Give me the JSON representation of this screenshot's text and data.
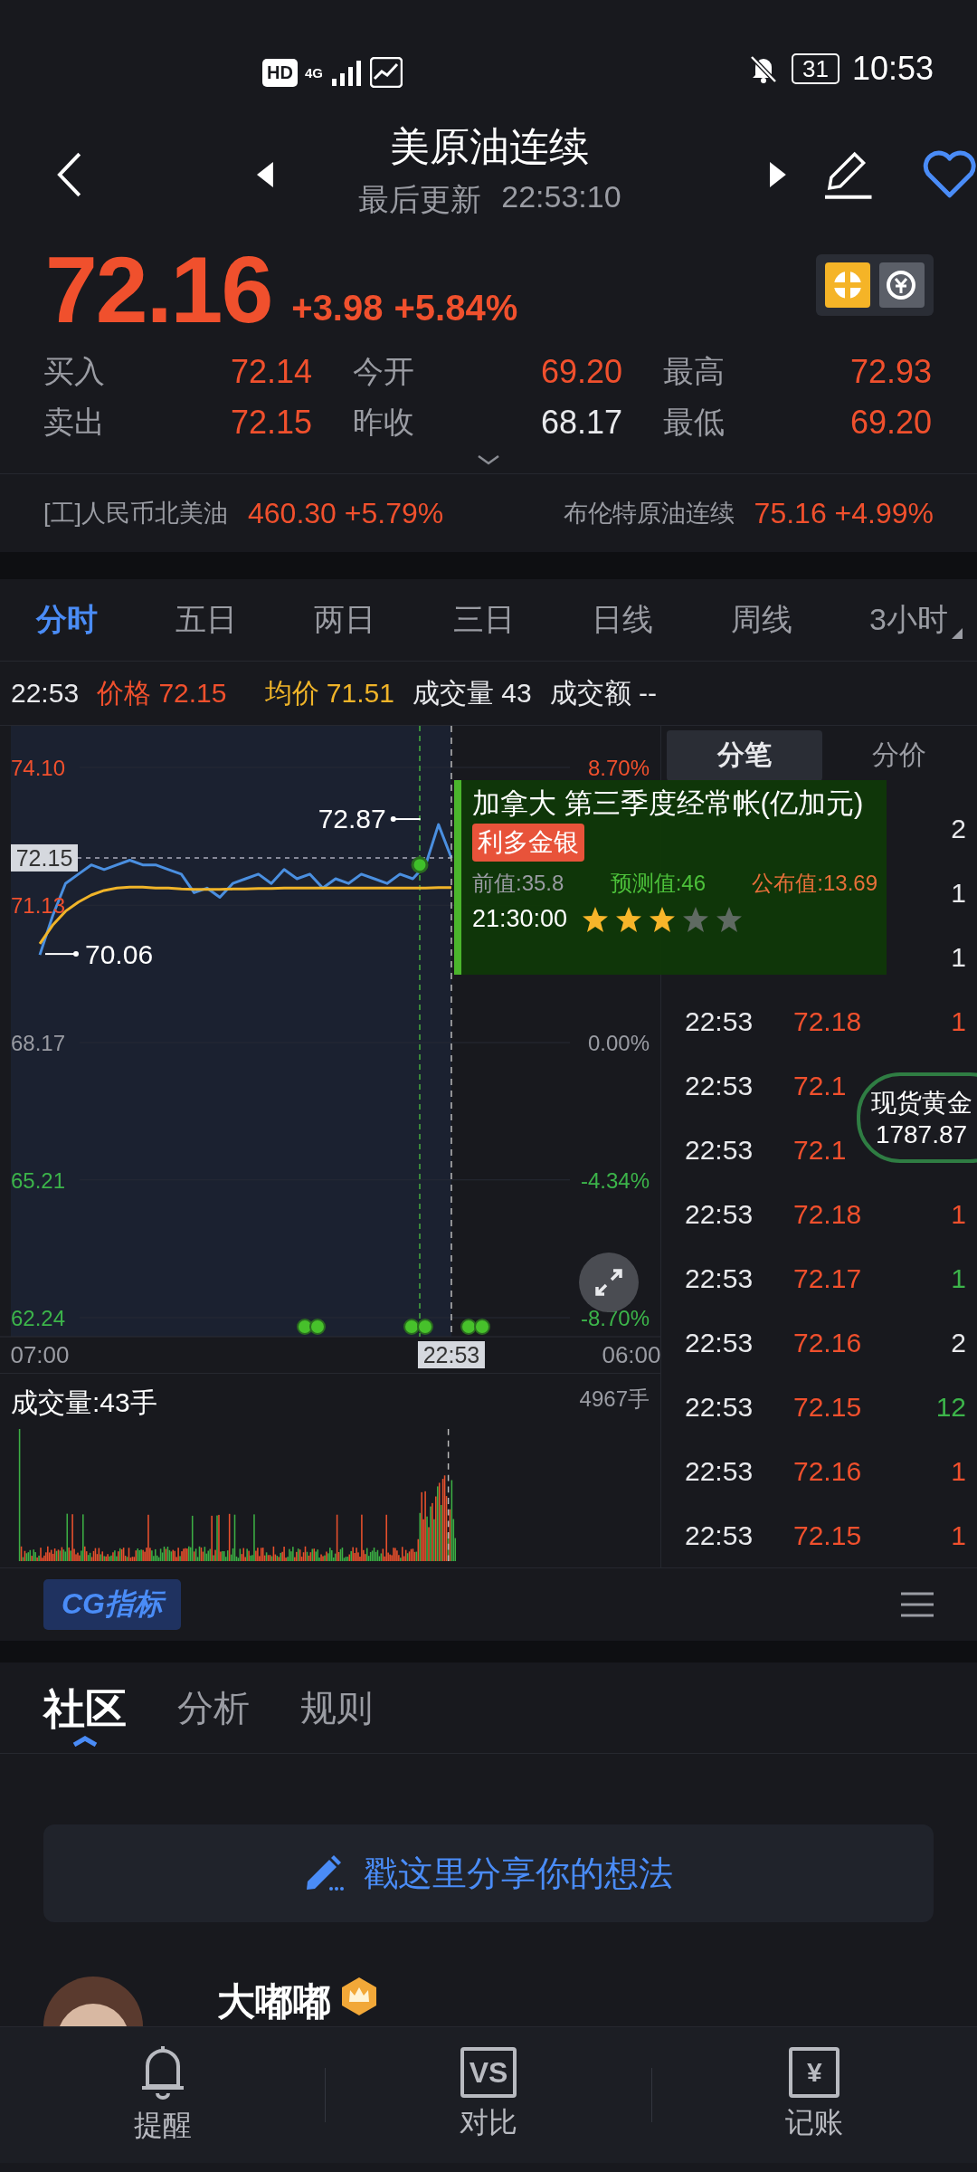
{
  "status_bar": {
    "hd": "HD",
    "network": "4G",
    "battery": "31",
    "time": "10:53"
  },
  "header": {
    "title": "美原油连续",
    "updated_label": "最后更新",
    "updated": "22:53:10"
  },
  "quote": {
    "price": "72.16",
    "change": "+3.98",
    "change_pct": "+5.84%",
    "color": "#f0502d",
    "stats": [
      {
        "label": "买入",
        "value": "72.14",
        "color": "#f0502d"
      },
      {
        "label": "今开",
        "value": "69.20",
        "color": "#f0502d"
      },
      {
        "label": "最高",
        "value": "72.93",
        "color": "#f0502d"
      },
      {
        "label": "卖出",
        "value": "72.15",
        "color": "#f0502d"
      },
      {
        "label": "昨收",
        "value": "68.17",
        "color": "#e8e9ec"
      },
      {
        "label": "最低",
        "value": "69.20",
        "color": "#f0502d"
      }
    ]
  },
  "related": [
    {
      "name": "[工]人民币北美油",
      "price": "460.30",
      "change": "+5.79%",
      "color": "#f0502d"
    },
    {
      "name": "布伦特原油连续",
      "price": "75.16",
      "change": "+4.99%",
      "color": "#f0502d"
    }
  ],
  "period_tabs": [
    {
      "label": "分时",
      "selected": true,
      "dropdown": false
    },
    {
      "label": "五日",
      "selected": false,
      "dropdown": false
    },
    {
      "label": "两日",
      "selected": false,
      "dropdown": false
    },
    {
      "label": "三日",
      "selected": false,
      "dropdown": false
    },
    {
      "label": "日线",
      "selected": false,
      "dropdown": false
    },
    {
      "label": "周线",
      "selected": false,
      "dropdown": false
    },
    {
      "label": "3小时",
      "selected": false,
      "dropdown": true
    }
  ],
  "info_line": {
    "time": "22:53",
    "items": [
      {
        "label": "价格",
        "value": "72.15",
        "kind": "price"
      },
      {
        "label": "均价",
        "value": "71.51",
        "kind": "average"
      },
      {
        "label": "成交量",
        "value": "43",
        "kind": "volume"
      },
      {
        "label": "成交额",
        "value": "--",
        "kind": "turnover"
      }
    ]
  },
  "price_chart": {
    "chart_data": {
      "type": "line",
      "categories": [
        "07:00",
        null,
        null,
        null,
        null,
        null,
        null,
        null,
        null,
        null,
        null,
        null,
        null,
        null,
        null,
        null,
        null,
        null,
        null,
        null,
        null,
        null,
        null,
        null,
        null,
        null,
        null,
        null,
        null,
        null,
        null,
        null,
        null,
        null,
        null,
        null,
        null,
        null,
        null,
        null,
        null,
        null,
        null,
        null,
        null,
        null,
        "06:00"
      ],
      "series": [
        {
          "color": "#4a8fe0",
          "values": [
            70.06,
            70.9,
            71.6,
            71.8,
            72.0,
            71.9,
            72.0,
            72.1,
            72.0,
            72.0,
            71.9,
            71.8,
            71.4,
            71.5,
            71.3,
            71.6,
            71.7,
            71.8,
            71.6,
            71.9,
            71.7,
            71.8,
            71.5,
            71.7,
            71.6,
            71.8,
            71.7,
            71.6,
            71.8,
            71.7,
            72.0,
            72.87,
            72.15,
            null,
            null,
            null,
            null,
            null,
            null,
            null,
            null,
            null,
            null,
            null,
            null,
            null,
            null
          ]
        },
        {
          "color": "#f0b429",
          "values": [
            70.3,
            70.7,
            71.0,
            71.2,
            71.35,
            71.45,
            71.5,
            71.52,
            71.52,
            71.5,
            71.5,
            71.48,
            71.47,
            71.47,
            71.47,
            71.48,
            71.48,
            71.49,
            71.49,
            71.5,
            71.5,
            71.5,
            71.5,
            71.5,
            71.5,
            71.5,
            71.5,
            71.5,
            71.5,
            71.5,
            71.5,
            71.51,
            71.51,
            null,
            null,
            null,
            null,
            null,
            null,
            null,
            null,
            null,
            null,
            null,
            null,
            null,
            null
          ]
        }
      ],
      "ylim": [
        62.24,
        74.1
      ],
      "grid": true,
      "yticks": [
        {
          "value": 74.1,
          "label": "74.10"
        },
        {
          "value": 71.13,
          "label": "71.13"
        },
        {
          "value": 68.17,
          "label": "68.17"
        },
        {
          "value": 65.21,
          "label": "65.21"
        },
        {
          "value": 62.24,
          "label": "62.24"
        }
      ]
    },
    "levels": [
      {
        "percent": "8.70%",
        "color": "#f0502d"
      },
      {
        "color": "#f0502d"
      },
      {
        "percent": "0.00%",
        "color": "#9a9ca3"
      },
      {
        "percent": "-4.34%",
        "color": "#3cb44a"
      },
      {
        "percent": "-8.70%",
        "color": "#3cb44a"
      }
    ],
    "max_label": "72.87",
    "min_label": "70.06",
    "last_tag": "72.15",
    "cursor_tag": "22:53"
  },
  "event_tooltip": {
    "title": "加拿大 第三季度经常帐(亿加元)",
    "tag": "利多金银",
    "previous": "前值:35.8",
    "forecast": "预测值:46",
    "actual": "公布值:13.69",
    "time": "21:30:00",
    "stars": 3
  },
  "volume_panel": {
    "label": "成交量:43手",
    "max": "4967手"
  },
  "trade_tabs": [
    {
      "label": "分笔",
      "selected": true
    },
    {
      "label": "分价",
      "selected": false
    }
  ],
  "trades": [
    {
      "volume": "2",
      "color": "#e8e9ec"
    },
    {
      "volume": "1",
      "color": "#e8e9ec"
    },
    {
      "volume": "1",
      "color": "#e8e9ec"
    },
    {
      "time": "22:53",
      "price": "72.18",
      "volume": "1",
      "color": "#f0502d"
    },
    {
      "time": "22:53",
      "price": "72.1"
    },
    {
      "time": "22:53",
      "price": "72.1"
    },
    {
      "time": "22:53",
      "price": "72.18",
      "volume": "1",
      "color": "#f0502d"
    },
    {
      "time": "22:53",
      "price": "72.17",
      "volume": "1",
      "color": "#3cb44a"
    },
    {
      "time": "22:53",
      "price": "72.16",
      "volume": "2",
      "color": "#e8e9ec"
    },
    {
      "time": "22:53",
      "price": "72.15",
      "volume": "12",
      "color": "#3cb44a"
    },
    {
      "time": "22:53",
      "price": "72.16",
      "volume": "1",
      "color": "#f0502d"
    },
    {
      "time": "22:53",
      "price": "72.15",
      "volume": "1",
      "color": "#f0502d"
    }
  ],
  "floating_quote": {
    "name": "现货黄金",
    "price": "1787.87"
  },
  "indicator_bar": {
    "label": "CG指标"
  },
  "community_tabs": [
    {
      "label": "社区",
      "selected": true
    },
    {
      "label": "分析",
      "selected": false
    },
    {
      "label": "规则",
      "selected": false
    }
  ],
  "share_button": {
    "label": "戳这里分享你的想法"
  },
  "post": {
    "author": "大嘟嘟"
  },
  "bottom_nav": [
    {
      "label": "提醒",
      "kind": "bell"
    },
    {
      "label": "对比",
      "kind": "vs",
      "icon_text": "VS"
    },
    {
      "label": "记账",
      "kind": "ledger",
      "icon_text": "¥"
    }
  ]
}
